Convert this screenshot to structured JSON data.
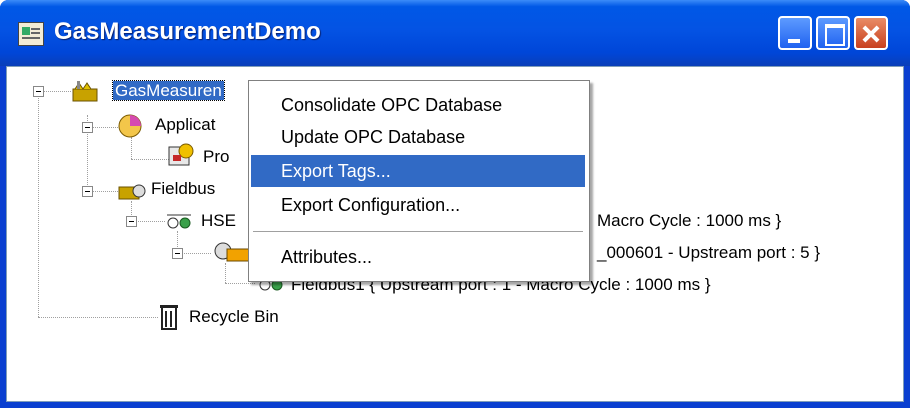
{
  "window": {
    "title": "GasMeasurementDemo"
  },
  "tree": {
    "root": "GasMeasurementDemo",
    "root_visible": "GasMeasuren",
    "application_visible": "Applicat",
    "program_visible": "Pro",
    "fieldbus_visible": "Fieldbus",
    "hse_visible": "HSE",
    "hse_suffix": "Macro Cycle : 1000 ms }",
    "device_suffix": "_000601 - Upstream port : 5 }",
    "fieldbus1_text": "Fieldbus1 { Upstream port : 1 - Macro Cycle : 1000 ms }",
    "recycle_bin": "Recycle Bin"
  },
  "context_menu": {
    "items": [
      {
        "label": "Consolidate OPC Database"
      },
      {
        "label": "Update OPC Database"
      },
      {
        "label": "Export Tags...",
        "highlighted": true
      },
      {
        "label": "Export Configuration..."
      },
      {
        "label": "Attributes..."
      }
    ]
  },
  "colors": {
    "selection": "#316ac5",
    "titlebar": "#0453e4",
    "close": "#d4502b"
  }
}
